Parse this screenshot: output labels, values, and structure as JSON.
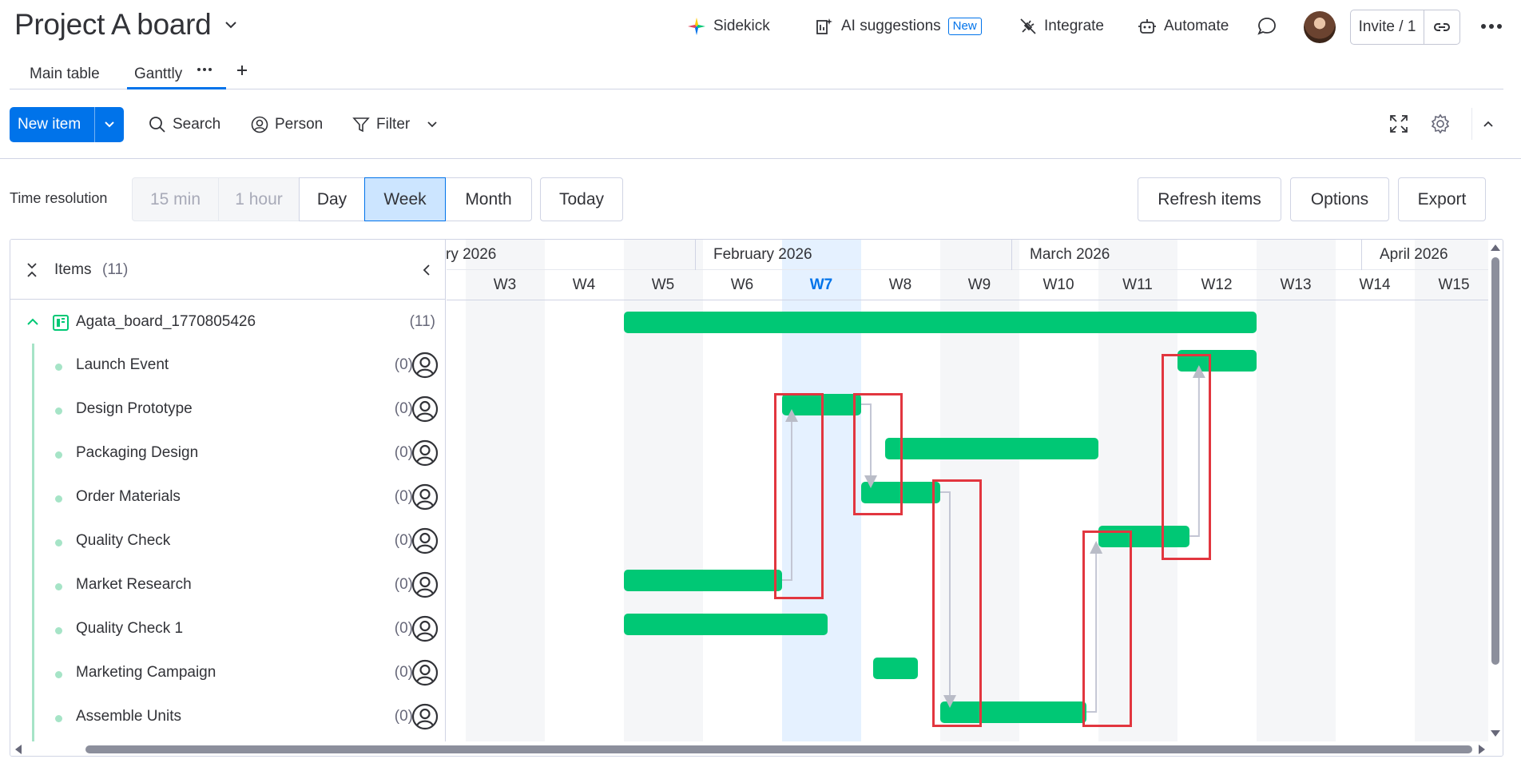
{
  "header": {
    "title": "Project A board",
    "actions": {
      "sidekick": "Sidekick",
      "ai_suggestions": "AI suggestions",
      "new_badge": "New",
      "integrate": "Integrate",
      "automate": "Automate"
    },
    "invite_label": "Invite / 1"
  },
  "tabs": [
    {
      "label": "Main table",
      "active": false
    },
    {
      "label": "Ganttly",
      "active": true
    }
  ],
  "toolbar": {
    "new_item": "New item",
    "search": "Search",
    "person": "Person",
    "filter": "Filter"
  },
  "time_resolution": {
    "label": "Time resolution",
    "options": [
      "15 min",
      "1 hour",
      "Day",
      "Week",
      "Month"
    ],
    "selected": "Week",
    "today": "Today"
  },
  "actions": {
    "refresh": "Refresh items",
    "options": "Options",
    "export": "Export"
  },
  "gantt": {
    "items_title": "Items",
    "items_count": "(11)",
    "group": {
      "name": "Agata_board_1770805426",
      "count": "(11)"
    },
    "rows": [
      {
        "label": "Launch Event",
        "count": "(0)"
      },
      {
        "label": "Design Prototype",
        "count": "(0)"
      },
      {
        "label": "Packaging Design",
        "count": "(0)"
      },
      {
        "label": "Order Materials",
        "count": "(0)"
      },
      {
        "label": "Quality Check",
        "count": "(0)"
      },
      {
        "label": "Market Research",
        "count": "(0)"
      },
      {
        "label": "Quality Check 1",
        "count": "(0)"
      },
      {
        "label": "Marketing Campaign",
        "count": "(0)"
      },
      {
        "label": "Assemble Units",
        "count": "(0)"
      }
    ],
    "months": [
      "ry 2026",
      "February 2026",
      "March 2026",
      "April 2026"
    ],
    "weeks": [
      "W3",
      "W4",
      "W5",
      "W6",
      "W7",
      "W8",
      "W9",
      "W10",
      "W11",
      "W12",
      "W13",
      "W14",
      "W15"
    ],
    "current_week": "W7"
  },
  "colors": {
    "accent": "#0073ea",
    "bar": "#00c875",
    "highlight_box": "#e2363f",
    "current_week_bg": "#e5f1ff"
  }
}
